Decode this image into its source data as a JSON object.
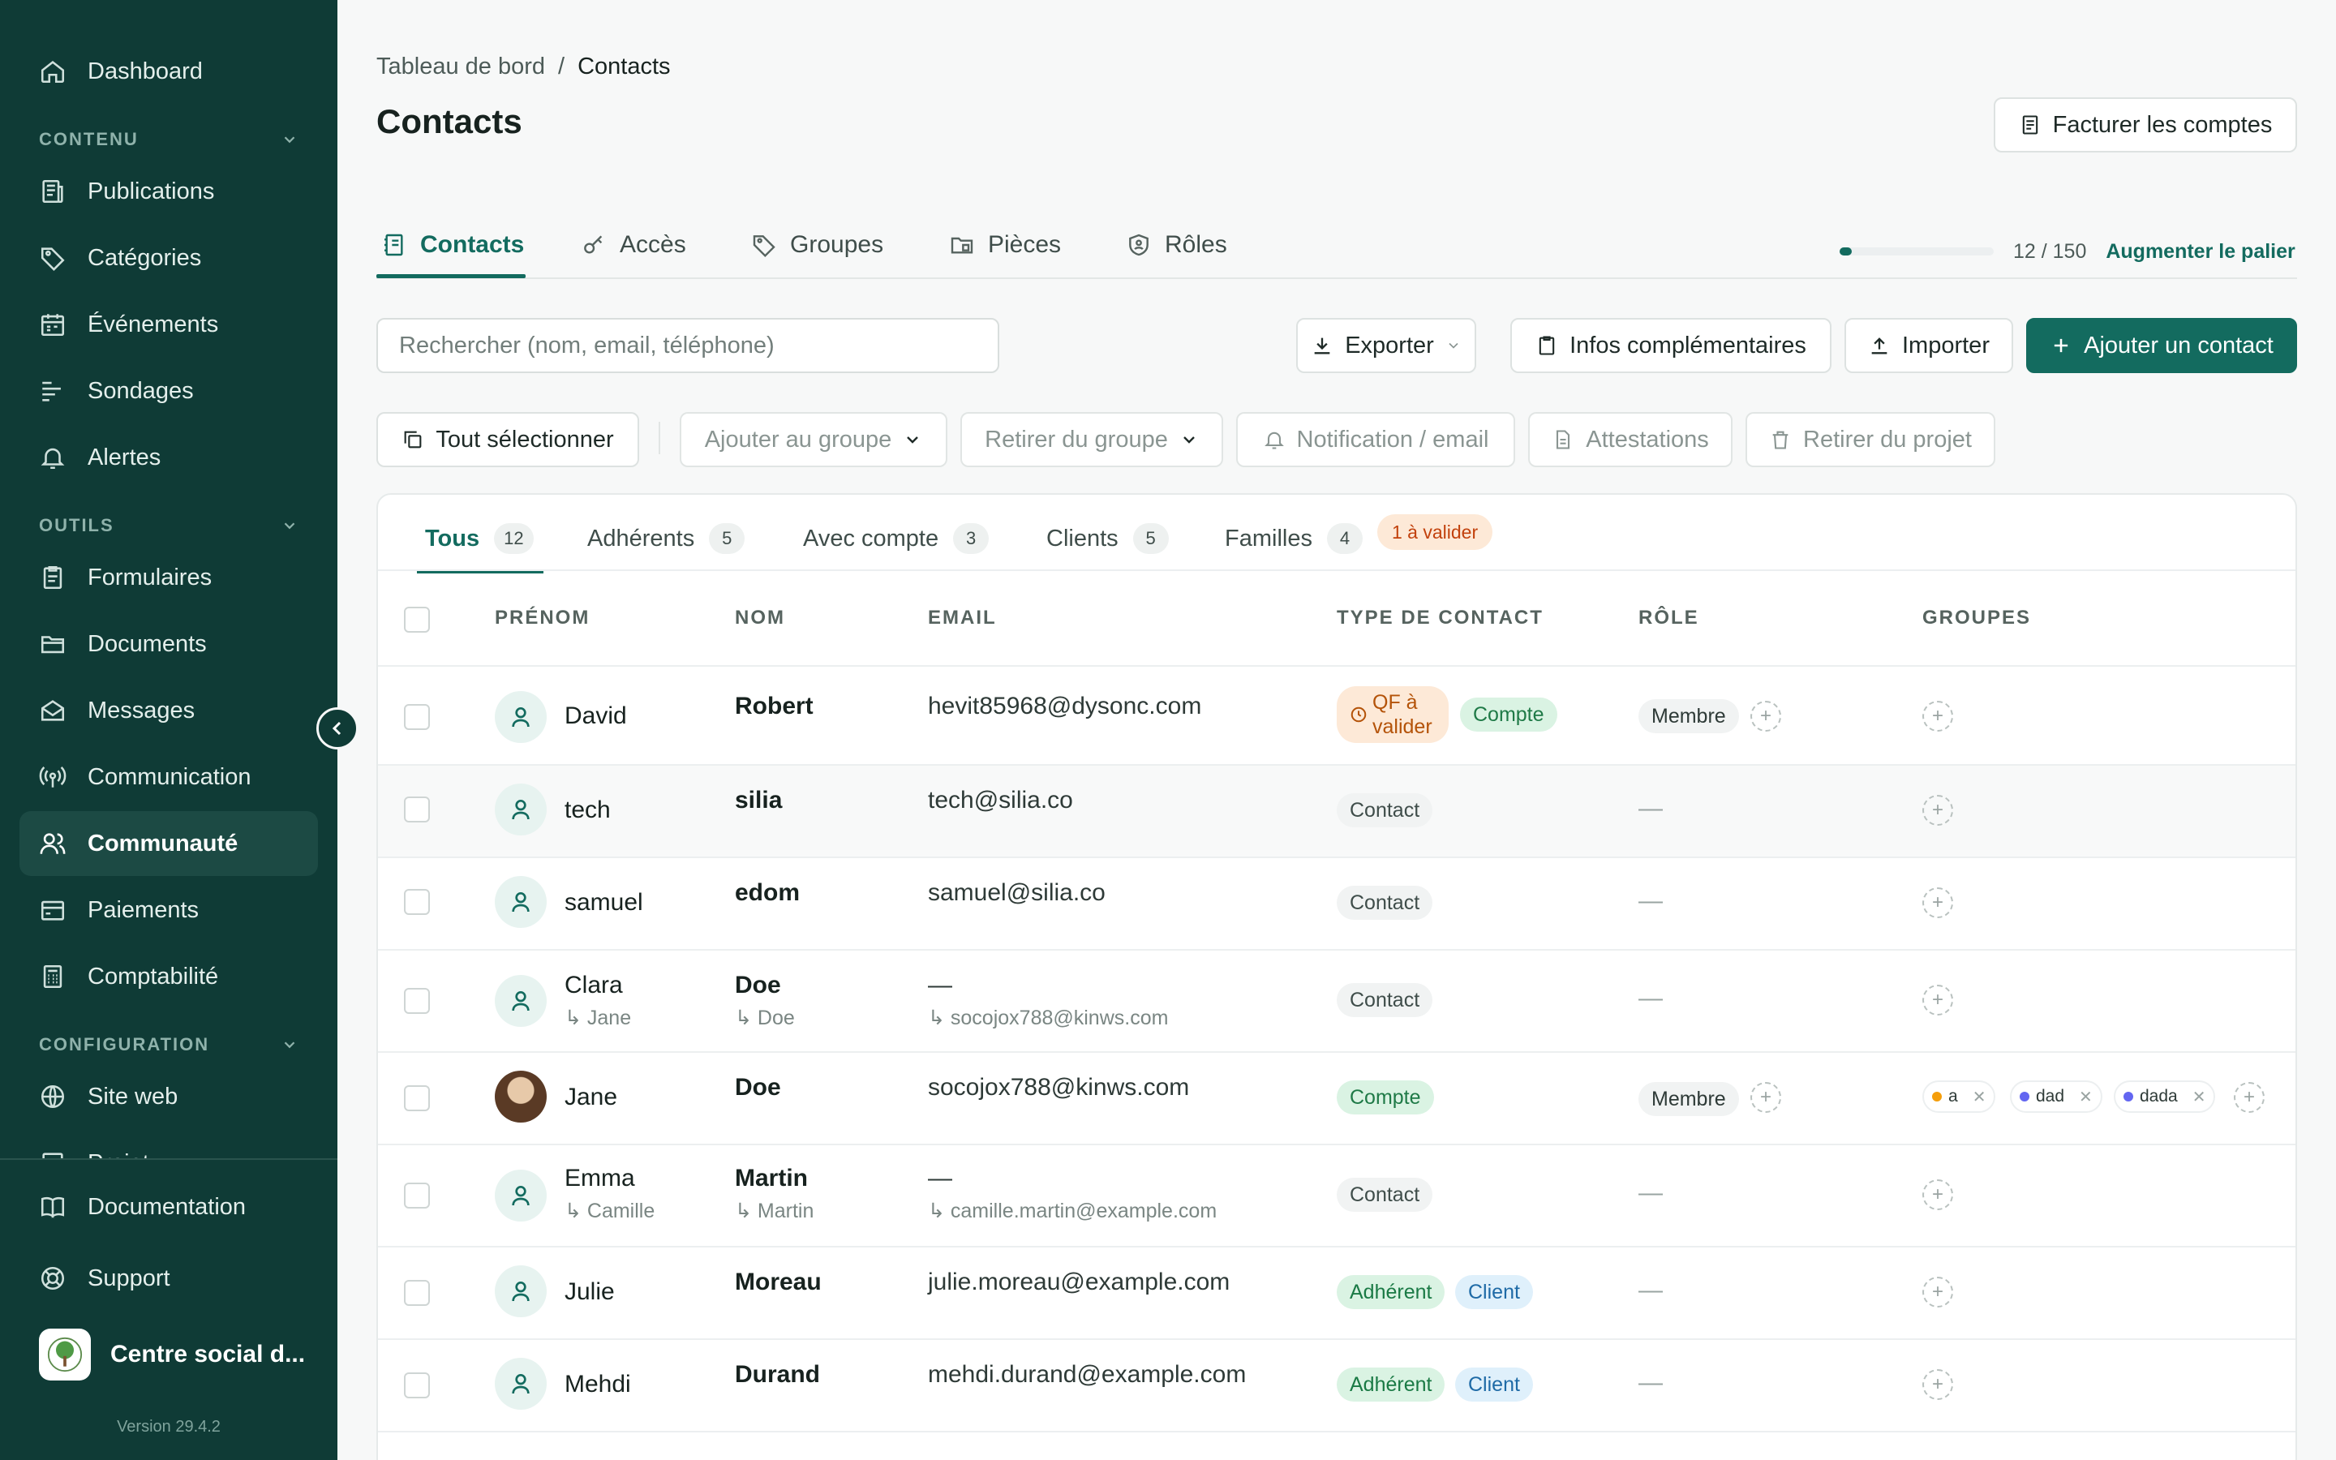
{
  "sidebar": {
    "dashboard": "Dashboard",
    "section_contenu": "CONTENU",
    "publications": "Publications",
    "categories": "Catégories",
    "evenements": "Événements",
    "sondages": "Sondages",
    "alertes": "Alertes",
    "section_outils": "OUTILS",
    "formulaires": "Formulaires",
    "documents": "Documents",
    "messages": "Messages",
    "communication": "Communication",
    "communaute": "Communauté",
    "paiements": "Paiements",
    "comptabilite": "Comptabilité",
    "section_configuration": "CONFIGURATION",
    "site_web": "Site web",
    "projet": "Projet",
    "documentation": "Documentation",
    "support": "Support",
    "org_name": "Centre social d...",
    "version": "Version 29.4.2"
  },
  "breadcrumb": {
    "parent": "Tableau de bord",
    "separator": "/",
    "current": "Contacts"
  },
  "page_title": "Contacts",
  "header_button": "Facturer les comptes",
  "tabs": [
    "Contacts",
    "Accès",
    "Groupes",
    "Pièces",
    "Rôles"
  ],
  "quota": {
    "used": 12,
    "max": 150,
    "text": "12 / 150",
    "upgrade": "Augmenter le palier",
    "fill_fraction": 0.08
  },
  "search": {
    "placeholder": "Rechercher (nom, email, téléphone)"
  },
  "actions": {
    "export": "Exporter",
    "infos": "Infos complémentaires",
    "import": "Importer",
    "add": "Ajouter un contact"
  },
  "bulk": {
    "select_all": "Tout sélectionner",
    "add_group": "Ajouter au groupe",
    "remove_group": "Retirer du groupe",
    "notification": "Notification / email",
    "attestations": "Attestations",
    "remove_project": "Retirer du projet"
  },
  "filters": {
    "tous": {
      "label": "Tous",
      "count": "12"
    },
    "adherents": {
      "label": "Adhérents",
      "count": "5"
    },
    "avec_compte": {
      "label": "Avec compte",
      "count": "3"
    },
    "clients": {
      "label": "Clients",
      "count": "5"
    },
    "familles": {
      "label": "Familles",
      "count": "4"
    },
    "pending": "1 à valider"
  },
  "columns": {
    "prenom": "PRÉNOM",
    "nom": "NOM",
    "email": "EMAIL",
    "type": "TYPE DE CONTACT",
    "role": "RÔLE",
    "groupes": "GROUPES"
  },
  "rows": [
    {
      "prenom": "David",
      "nom": "Robert",
      "email": "hevit85968@dysonc.com",
      "badge_qf": "QF à valider",
      "badge_compte": "Compte",
      "role": "Membre"
    },
    {
      "prenom": "tech",
      "nom": "silia",
      "email": "tech@silia.co",
      "type": "Contact",
      "role": "—"
    },
    {
      "prenom": "samuel",
      "nom": "edom",
      "email": "samuel@silia.co",
      "type": "Contact",
      "role": "—"
    },
    {
      "prenom": "Clara",
      "prenom_sub": "↳ Jane",
      "nom": "Doe",
      "nom_sub": "↳ Doe",
      "email": "—",
      "email_sub": "↳ socojox788@kinws.com",
      "type": "Contact",
      "role": "—"
    },
    {
      "prenom": "Jane",
      "nom": "Doe",
      "email": "socojox788@kinws.com",
      "type": "Compte",
      "role": "Membre",
      "groups": [
        "a",
        "dad",
        "dada"
      ]
    },
    {
      "prenom": "Emma",
      "prenom_sub": "↳ Camille",
      "nom": "Martin",
      "nom_sub": "↳ Martin",
      "email": "—",
      "email_sub": "↳ camille.martin@example.com",
      "type": "Contact",
      "role": "—"
    },
    {
      "prenom": "Julie",
      "nom": "Moreau",
      "email": "julie.moreau@example.com",
      "type": "Adhérent",
      "type2": "Client",
      "role": "—"
    },
    {
      "prenom": "Mehdi",
      "nom": "Durand",
      "email": "mehdi.durand@example.com",
      "type": "Adhérent",
      "type2": "Client",
      "role": "—"
    }
  ],
  "colors": {
    "sidebar_bg": "#0f3b36",
    "accent": "#136b5f",
    "tag_orange": "#f59e0b",
    "tag_indigo": "#6366f1"
  },
  "icons": {
    "user": "user-icon",
    "plus": "plus-icon",
    "clock": "clock-icon"
  }
}
